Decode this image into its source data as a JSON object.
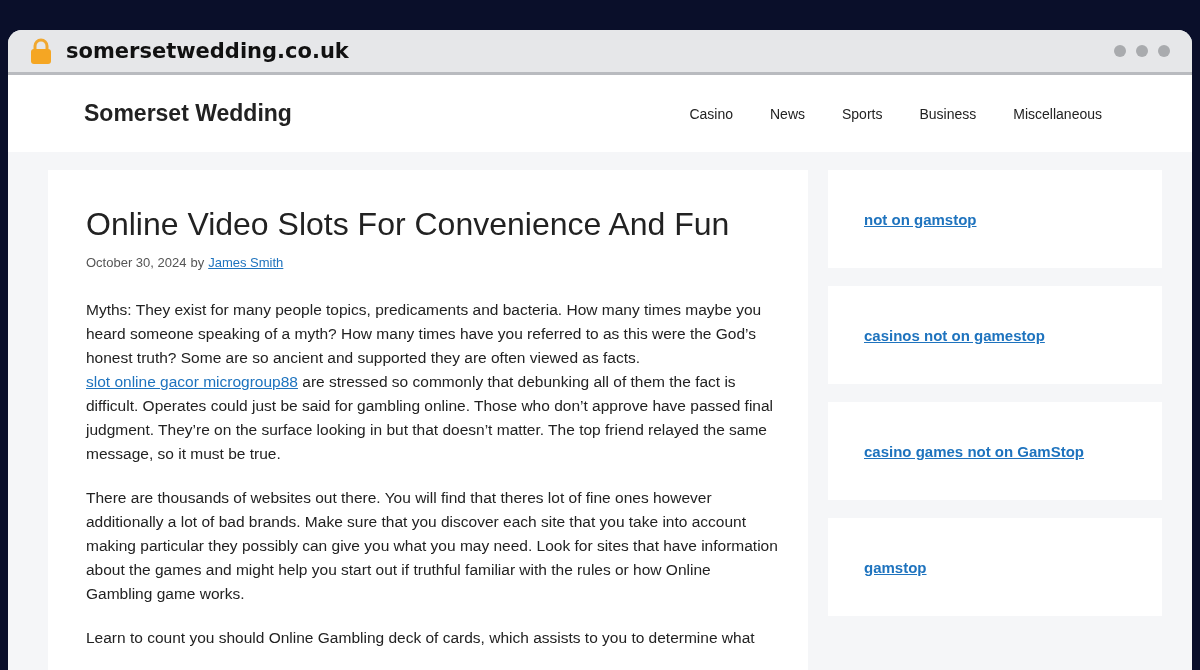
{
  "browser": {
    "url": "somersetwedding.co.uk"
  },
  "site": {
    "title": "Somerset Wedding",
    "nav": [
      "Casino",
      "News",
      "Sports",
      "Business",
      "Miscellaneous"
    ]
  },
  "article": {
    "title": "Online Video Slots For Convenience And Fun",
    "date": "October 30, 2024",
    "by": "by",
    "author": "James Smith",
    "paragraphs": [
      [
        {
          "kind": "text",
          "text": "Myths: They exist for many people topics, predicaments and bacteria. How many times maybe you heard someone speaking of a myth? How many times have you referred to as this were the God’s honest truth? Some are so ancient and supported they are often viewed as facts. "
        },
        {
          "kind": "link",
          "text": "slot online gacor microgroup88"
        },
        {
          "kind": "text",
          "text": " are stressed so commonly that debunking all of them the fact is difficult. Operates could just be said for gambling online. Those who don’t approve have passed final judgment. They’re on the surface looking in but that doesn’t matter. The top friend relayed the same message, so it must be true."
        }
      ],
      [
        {
          "kind": "text",
          "text": "There are thousands of websites out there. You will find that theres lot of fine ones however additionally a lot of bad brands. Make sure that you discover each site that you take into account making particular they possibly can give you what you may need. Look for sites that have information about the games and might help you start out if truthful familiar with the rules or how Online Gambling game works."
        }
      ],
      [
        {
          "kind": "text",
          "text": "Learn to count you should Online Gambling deck of cards, which assists to you to determine what"
        }
      ]
    ]
  },
  "sidebar": [
    "not on gamstop",
    "casinos not on gamestop",
    "casino games not on GamStop",
    "gamstop"
  ]
}
